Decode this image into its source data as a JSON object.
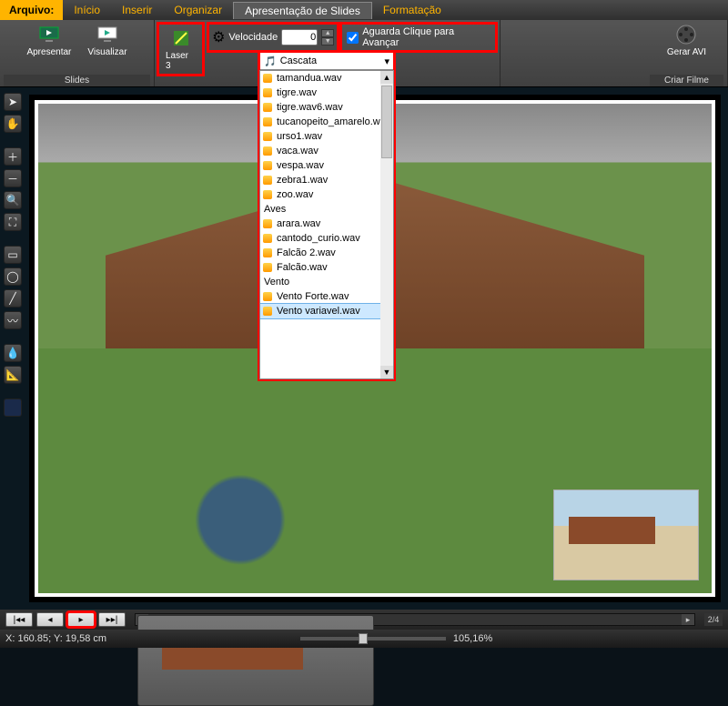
{
  "menu": {
    "file": "Arquivo:",
    "tabs": [
      "Início",
      "Inserir",
      "Organizar",
      "Apresentação de Slides",
      "Formatação"
    ],
    "active": 3
  },
  "ribbon": {
    "group_slides": {
      "label": "Slides",
      "present": "Apresentar",
      "view": "Visualizar"
    },
    "laser": "Laser 3",
    "speed": {
      "label": "Velocidade",
      "value": "0"
    },
    "wait_click": "Aguarda Clique para Avançar",
    "group_movie": {
      "label": "Criar Filme",
      "avi": "Gerar AVI"
    }
  },
  "dropdown": {
    "selected": "Cascata",
    "items": [
      {
        "t": "item",
        "label": "tamandua.wav"
      },
      {
        "t": "item",
        "label": "tigre.wav"
      },
      {
        "t": "item",
        "label": "tigre.wav6.wav"
      },
      {
        "t": "item",
        "label": "tucanopeito_amarelo.wav"
      },
      {
        "t": "item",
        "label": "urso1.wav"
      },
      {
        "t": "item",
        "label": "vaca.wav"
      },
      {
        "t": "item",
        "label": "vespa.wav"
      },
      {
        "t": "item",
        "label": "zebra1.wav"
      },
      {
        "t": "item",
        "label": "zoo.wav"
      },
      {
        "t": "cat",
        "label": "Aves"
      },
      {
        "t": "item",
        "label": "arara.wav"
      },
      {
        "t": "item",
        "label": "cantodo_curio.wav"
      },
      {
        "t": "item",
        "label": "Falcão 2.wav"
      },
      {
        "t": "item",
        "label": "Falcão.wav"
      },
      {
        "t": "cat",
        "label": "Vento"
      },
      {
        "t": "item",
        "label": "Vento Forte.wav"
      },
      {
        "t": "item",
        "label": "Vento variavel.wav",
        "h": true
      }
    ]
  },
  "status": {
    "coords": "X: 160.85; Y: 19,58 cm",
    "zoom": "105,16%",
    "page": "2/4"
  }
}
